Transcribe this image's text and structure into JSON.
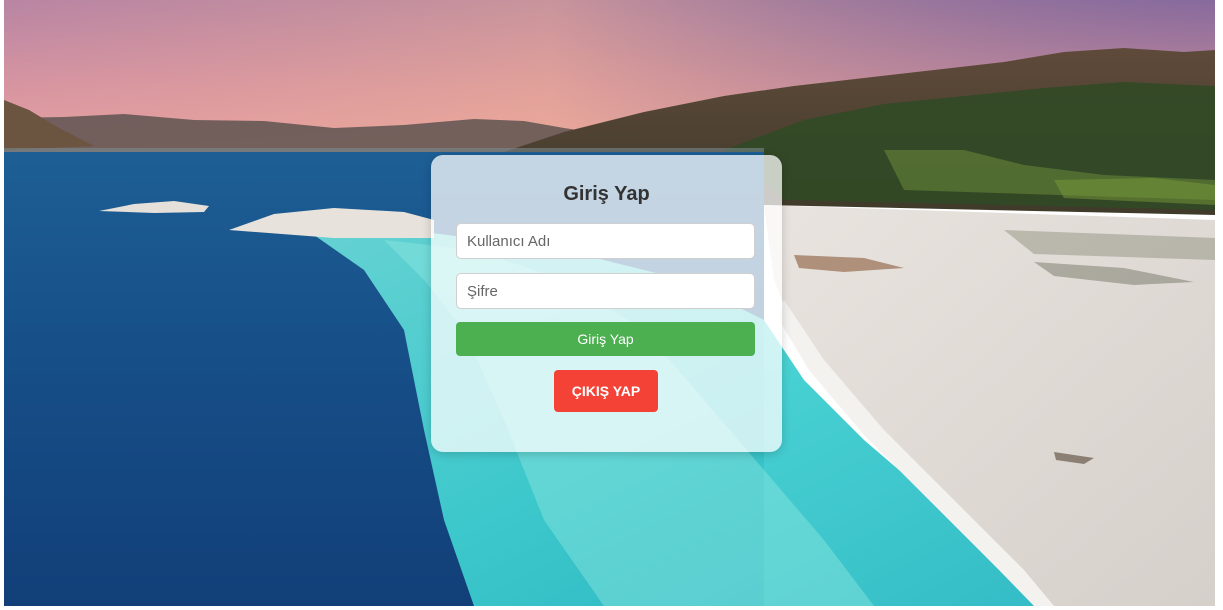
{
  "login": {
    "title": "Giriş Yap",
    "username_placeholder": "Kullanıcı Adı",
    "username_value": "",
    "password_placeholder": "Şifre",
    "password_value": "",
    "login_button_label": "Giriş Yap",
    "exit_button_label": "ÇIKIŞ YAP"
  },
  "colors": {
    "login_button": "#4caf50",
    "exit_button": "#f44336",
    "card_background": "rgba(255,255,255,0.74)"
  }
}
